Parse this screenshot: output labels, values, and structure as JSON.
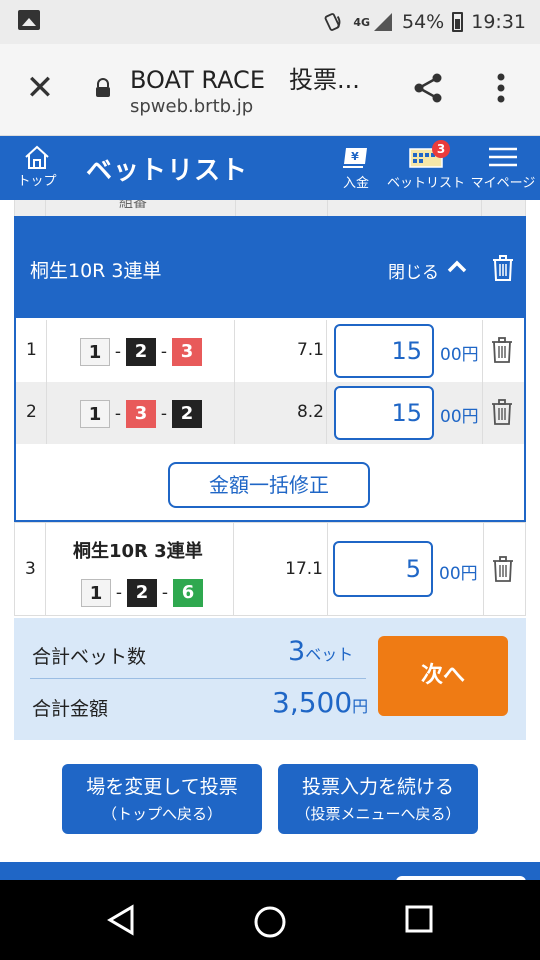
{
  "status_bar": {
    "network": "4G",
    "battery": "54%",
    "time": "19:31"
  },
  "browser": {
    "title": "BOAT RACE　投票...",
    "url": "spweb.brtb.jp"
  },
  "header": {
    "title": "ベットリスト",
    "nav": {
      "home": "トップ",
      "deposit": "入金",
      "betlist": "ベットリスト",
      "betlist_badge": "3",
      "mypage": "マイページ"
    }
  },
  "table": {
    "stub_header": "組番"
  },
  "group": {
    "race": "桐生10R 3連単",
    "close_label": "閉じる",
    "bets": [
      {
        "no": "1",
        "boats": [
          "1",
          "2",
          "3"
        ],
        "odds": "7.1",
        "amount": "15",
        "unit": "00円"
      },
      {
        "no": "2",
        "boats": [
          "1",
          "3",
          "2"
        ],
        "odds": "8.2",
        "amount": "15",
        "unit": "00円"
      }
    ],
    "bulk_edit": "金額一括修正"
  },
  "single": {
    "no": "3",
    "race": "桐生10R 3連単",
    "boats": [
      "1",
      "2",
      "6"
    ],
    "odds": "17.1",
    "amount": "5",
    "unit": "00円"
  },
  "summary": {
    "bet_count_label": "合計ベット数",
    "bet_count": "3",
    "bet_count_unit": "ベット",
    "total_label": "合計金額",
    "total": "3,500",
    "total_unit": "円",
    "next": "次へ"
  },
  "actions": {
    "change_venue": "場を変更して投票",
    "change_venue_sub": "（トップへ戻る）",
    "continue": "投票入力を続ける",
    "continue_sub": "（投票メニューへ戻る）"
  },
  "colors": {
    "primary": "#1f66c6",
    "next_button": "#ef7b14",
    "boat_1": "#f4f4f4",
    "boat_2": "#222222",
    "boat_3": "#e85a5a",
    "boat_6": "#2fa84f",
    "summary_bg": "#d9e8f8"
  }
}
